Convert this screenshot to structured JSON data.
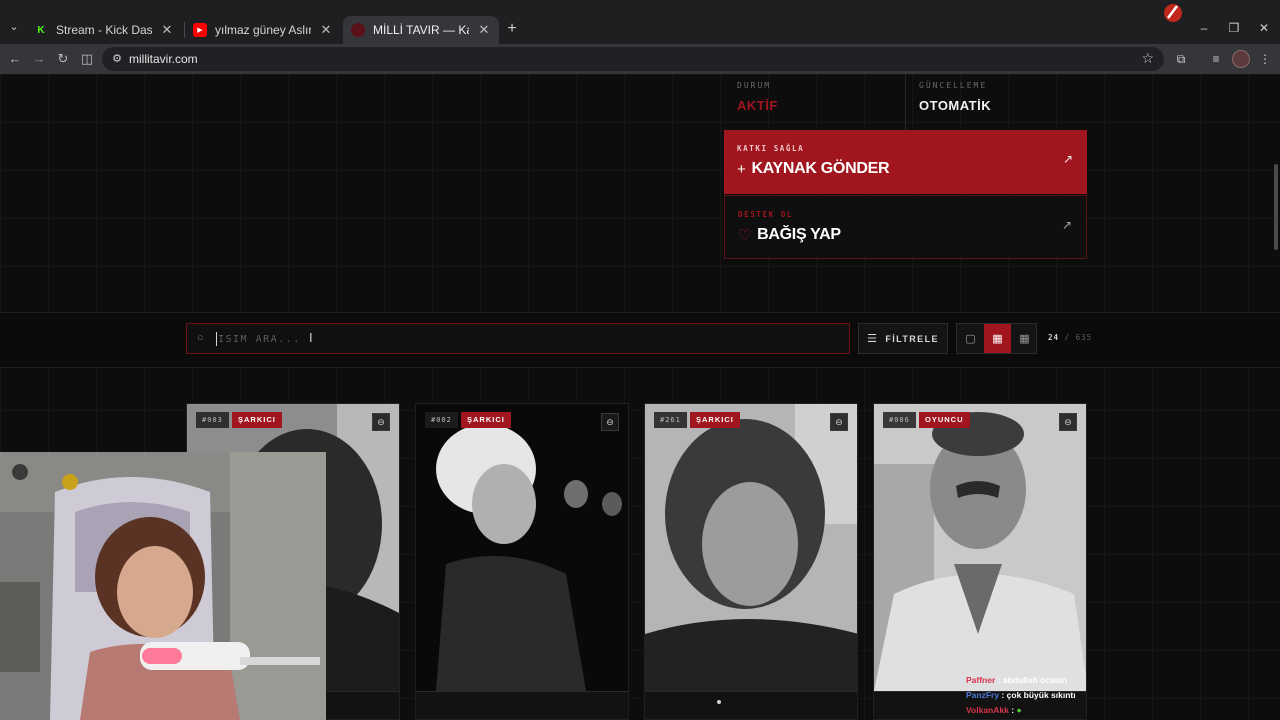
{
  "browser": {
    "tabs": [
      {
        "title": "Stream - Kick Dashboard",
        "favicon": "kick-icon",
        "active": false
      },
      {
        "title": "yılmaz güney Aslında Kimdi? | Y",
        "favicon": "youtube-icon",
        "active": false
      },
      {
        "title": "MİLLİ TAVIR — Kamuya Açık Pe",
        "favicon": "site-icon",
        "active": true
      }
    ],
    "url": "millitavir.com"
  },
  "status": {
    "durum_label": "DURUM",
    "durum_value": "AKTİF",
    "guncelleme_label": "GÜNCELLEME",
    "guncelleme_value": "OTOMATİK"
  },
  "cta": {
    "primary": {
      "label": "KATKI SAĞLA",
      "title": "KAYNAK GÖNDER",
      "icon": "plus-icon"
    },
    "secondary": {
      "label": "DESTEK OL",
      "title": "BAĞIŞ YAP",
      "icon": "heart-icon"
    }
  },
  "toolbar": {
    "search_placeholder": "İSİM ARA...",
    "filter_label": "FİLTRELE",
    "shown": "24",
    "separator": "/",
    "total": "635"
  },
  "cards": [
    {
      "num": "#003",
      "category": "ŞARKICI"
    },
    {
      "num": "#002",
      "category": "ŞARKICI"
    },
    {
      "num": "#261",
      "category": "ŞARKICI"
    },
    {
      "num": "#006",
      "category": "OYUNCU"
    }
  ],
  "chat": [
    {
      "user": "Paffner",
      "msg": ": abdullah öcalan"
    },
    {
      "user": "PanzFry",
      "msg": ": çok büyük sıkıntı"
    },
    {
      "user": "VolkanAkk",
      "msg": ":"
    }
  ],
  "colors": {
    "accent": "#a0151e",
    "background": "#0d0d0e"
  }
}
